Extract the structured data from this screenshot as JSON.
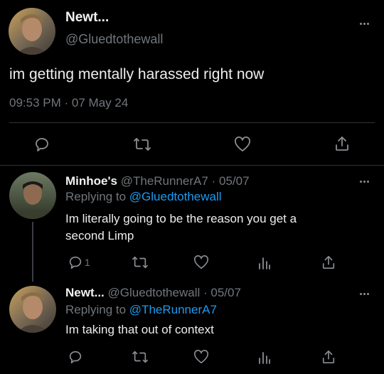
{
  "main_tweet": {
    "display_name": "Newt...",
    "handle": "@Gluedtothewall",
    "text": "im getting mentally harassed right now",
    "time": "09:53 PM",
    "separator": "·",
    "date": "07 May 24"
  },
  "reply1": {
    "display_name": "Minhoe's",
    "handle": "@TheRunnerA7",
    "separator": "·",
    "date": "05/07",
    "replying_label": "Replying to",
    "replying_to": "@Gluedtothewall",
    "text_line1": "Im literally going to be the reason you get a",
    "text_line2": "second Limp",
    "reply_count": "1"
  },
  "reply2": {
    "display_name": "Newt...",
    "handle": "@Gluedtothewall",
    "separator": "·",
    "date": "05/07",
    "replying_label": "Replying to",
    "replying_to": "@TheRunnerA7",
    "text": "Im taking that out of context"
  },
  "colors": {
    "background": "#000000",
    "text": "#e7e9ea",
    "muted": "#71767b",
    "link": "#1d9bf0",
    "divider": "#2f3336"
  },
  "icons": [
    "more-icon",
    "reply-icon",
    "retweet-icon",
    "like-icon",
    "share-icon",
    "views-icon"
  ]
}
